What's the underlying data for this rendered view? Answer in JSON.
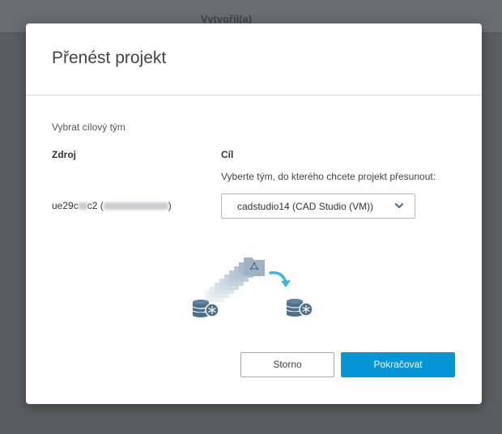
{
  "background": {
    "column_header": "Vytvořil(a)"
  },
  "dialog": {
    "title": "Přenést projekt",
    "section_label": "Vybrat cílový tým",
    "source": {
      "heading": "Zdroj",
      "value_visible": "ue29c",
      "value_suffix": "c2 (",
      "value_close": ")"
    },
    "target": {
      "heading": "Cíl",
      "hint": "Vyberte tým, do kterého chcete projekt přesunout:",
      "selected_team": "cadstudio14 (CAD Studio (VM))"
    },
    "buttons": {
      "cancel": "Storno",
      "continue": "Pokračovat"
    }
  },
  "colors": {
    "accent": "#0696d7",
    "overlay": "#5b5e61",
    "illustration": "#4c6f8c",
    "arrow": "#3ab4e6"
  },
  "icons": [
    "chevron-down-icon",
    "database-icon",
    "folder-icon",
    "transfer-arrow-icon"
  ]
}
